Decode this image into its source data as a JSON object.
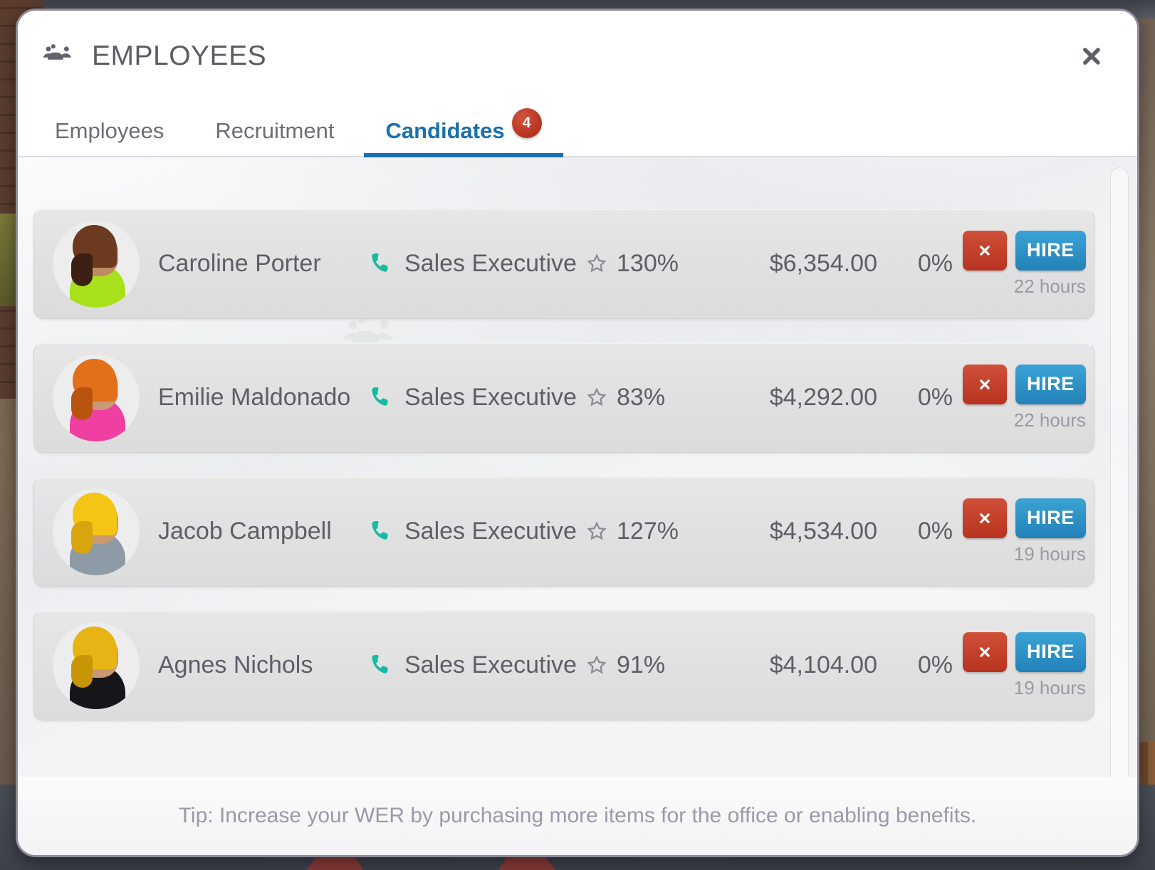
{
  "window": {
    "title": "EMPLOYEES",
    "title_icon": "people-icon",
    "close_icon": "close-icon"
  },
  "tabs": [
    {
      "label": "Employees",
      "active": false,
      "badge": null
    },
    {
      "label": "Recruitment",
      "active": false,
      "badge": null
    },
    {
      "label": "Candidates",
      "active": true,
      "badge": "4"
    }
  ],
  "colors": {
    "accent_blue": "#1a6fb0",
    "hire_blue": "#2281b8",
    "reject_red": "#b8331f",
    "badge_red": "#b5331f",
    "phone_teal": "#16bba0",
    "text_gray": "#5e5e68",
    "muted_gray": "#9a9aa3",
    "row_bg": "#e3e3e4",
    "modal_border": "#8d8b9b"
  },
  "list": {
    "reject_icon": "close-icon",
    "hire_label": "HIRE",
    "role_icon": "phone-icon",
    "rating_icon": "star-icon",
    "candidates": [
      {
        "name": "Caroline Porter",
        "role": "Sales Executive",
        "rating": "130%",
        "salary": "$6,354.00",
        "bonus": "0%",
        "timer": "22 hours",
        "avatar": {
          "hair": "#6b3a21",
          "hair_dark": "#3c2013",
          "shirt": "#a8e01c",
          "skin": "#c08a62"
        }
      },
      {
        "name": "Emilie Maldonado",
        "role": "Sales Executive",
        "rating": "83%",
        "salary": "$4,292.00",
        "bonus": "0%",
        "timer": "22 hours",
        "avatar": {
          "hair": "#e2701a",
          "hair_dark": "#b8540d",
          "shirt": "#ef3fa0",
          "skin": "#c89a76"
        }
      },
      {
        "name": "Jacob Campbell",
        "role": "Sales Executive",
        "rating": "127%",
        "salary": "$4,534.00",
        "bonus": "0%",
        "timer": "19 hours",
        "avatar": {
          "hair": "#f5c516",
          "hair_dark": "#d8a50c",
          "shirt": "#8e9aa6",
          "skin": "#c99a72"
        }
      },
      {
        "name": "Agnes Nichols",
        "role": "Sales Executive",
        "rating": "91%",
        "salary": "$4,104.00",
        "bonus": "0%",
        "timer": "19 hours",
        "avatar": {
          "hair": "#e8b415",
          "hair_dark": "#c89605",
          "shirt": "#16161a",
          "skin": "#c79a74"
        }
      }
    ]
  },
  "footer": {
    "tip": "Tip: Increase your WER by purchasing more items for the office or enabling benefits."
  }
}
